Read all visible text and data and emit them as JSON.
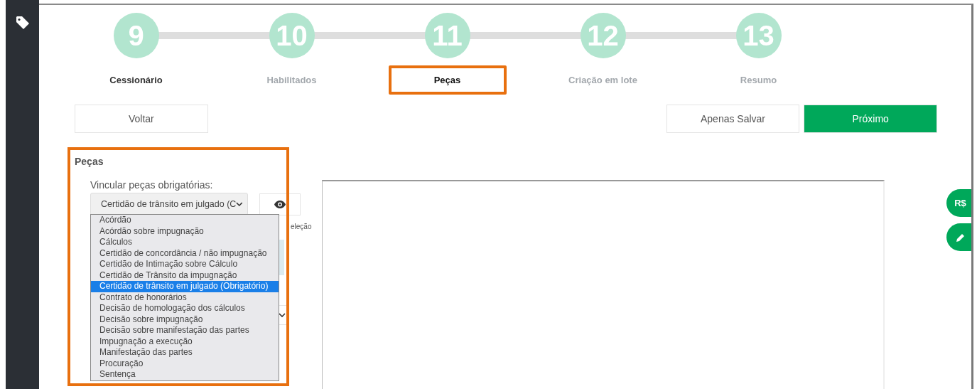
{
  "steps": [
    {
      "number": "9",
      "label": "Cessionário",
      "completed": true,
      "selected": false,
      "highlighted": false
    },
    {
      "number": "10",
      "label": "Habilitados",
      "completed": false,
      "selected": false,
      "highlighted": false
    },
    {
      "number": "11",
      "label": "Peças",
      "completed": false,
      "selected": true,
      "highlighted": true
    },
    {
      "number": "12",
      "label": "Criação em lote",
      "completed": false,
      "selected": false,
      "highlighted": false
    },
    {
      "number": "13",
      "label": "Resumo",
      "completed": false,
      "selected": false,
      "highlighted": false
    }
  ],
  "actions": {
    "back": "Voltar",
    "save": "Apenas Salvar",
    "next": "Próximo"
  },
  "section": {
    "title": "Peças",
    "highlighted": true,
    "field_label": "Vincular peças obrigatórias:",
    "select_value": "Certidão de trânsito em julgado (C",
    "hint": "eleção",
    "options": [
      {
        "label": "Acórdão",
        "selected": false
      },
      {
        "label": "Acórdão sobre impugnação",
        "selected": false
      },
      {
        "label": "Cálculos",
        "selected": false
      },
      {
        "label": "Certidão de concordância / não impugnação",
        "selected": false
      },
      {
        "label": "Certidão de Intimação sobre Cálculo",
        "selected": false
      },
      {
        "label": "Certidão de Trânsito da impugnação",
        "selected": false
      },
      {
        "label": "Certidão de trânsito em julgado (Obrigatório)",
        "selected": true
      },
      {
        "label": "Contrato de honorários",
        "selected": false
      },
      {
        "label": "Decisão de homologação dos cálculos",
        "selected": false
      },
      {
        "label": "Decisão sobre impugnação",
        "selected": false
      },
      {
        "label": "Decisão sobre manifestação das partes",
        "selected": false
      },
      {
        "label": "Impugnação a execução",
        "selected": false
      },
      {
        "label": "Manifestação das partes",
        "selected": false
      },
      {
        "label": "Procuração",
        "selected": false
      },
      {
        "label": "Sentença",
        "selected": false
      }
    ]
  },
  "side_tabs": [
    {
      "kind": "text",
      "label": "R$"
    },
    {
      "kind": "pencil"
    }
  ]
}
